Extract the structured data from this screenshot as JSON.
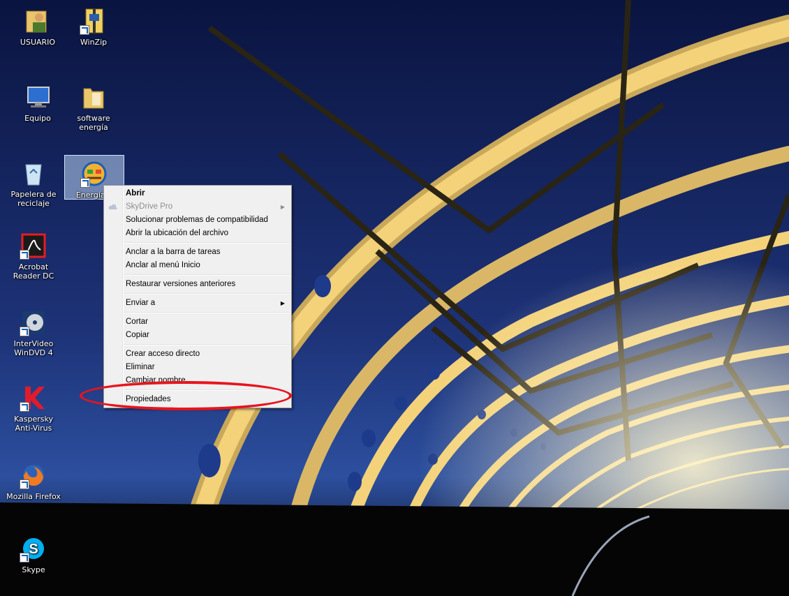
{
  "desktop": {
    "icons": [
      {
        "label": "USUARIO",
        "icon": "user-folder-icon"
      },
      {
        "label": "WinZip",
        "icon": "winzip-icon"
      },
      {
        "label": "Equipo",
        "icon": "computer-icon"
      },
      {
        "label": "software energía",
        "icon": "folder-icon"
      },
      {
        "label": "Papelera de reciclaje",
        "icon": "recycle-bin-icon"
      },
      {
        "label": "Energía 3",
        "icon": "energia-app-icon"
      },
      {
        "label": "Acrobat Reader DC",
        "icon": "acrobat-icon"
      },
      {
        "label": "InterVideo WinDVD 4",
        "icon": "windvd-icon"
      },
      {
        "label": "Kaspersky Anti-Virus",
        "icon": "kaspersky-icon"
      },
      {
        "label": "Mozilla Firefox",
        "icon": "firefox-icon"
      },
      {
        "label": "Skype",
        "icon": "skype-icon"
      }
    ]
  },
  "context_menu": {
    "items": [
      {
        "label": "Abrir",
        "bold": true
      },
      {
        "label": "SkyDrive Pro",
        "disabled": true,
        "submenu": true,
        "icon": "cloud-icon"
      },
      {
        "label": "Solucionar problemas de compatibilidad"
      },
      {
        "label": "Abrir la ubicación del archivo"
      },
      {
        "label": "Anclar a la barra de tareas"
      },
      {
        "label": "Anclar al menú Inicio"
      },
      {
        "label": "Restaurar versiones anteriores"
      },
      {
        "label": "Enviar a",
        "submenu": true
      },
      {
        "label": "Cortar"
      },
      {
        "label": "Copiar"
      },
      {
        "label": "Crear acceso directo"
      },
      {
        "label": "Eliminar"
      },
      {
        "label": "Cambiar nombre"
      },
      {
        "label": "Propiedades",
        "highlighted": true
      }
    ]
  },
  "colors": {
    "annotation": "#e8141c",
    "sky_top": "#0a1440",
    "sky_bottom": "#2c4f9e",
    "bridge": "#f3d27a"
  }
}
